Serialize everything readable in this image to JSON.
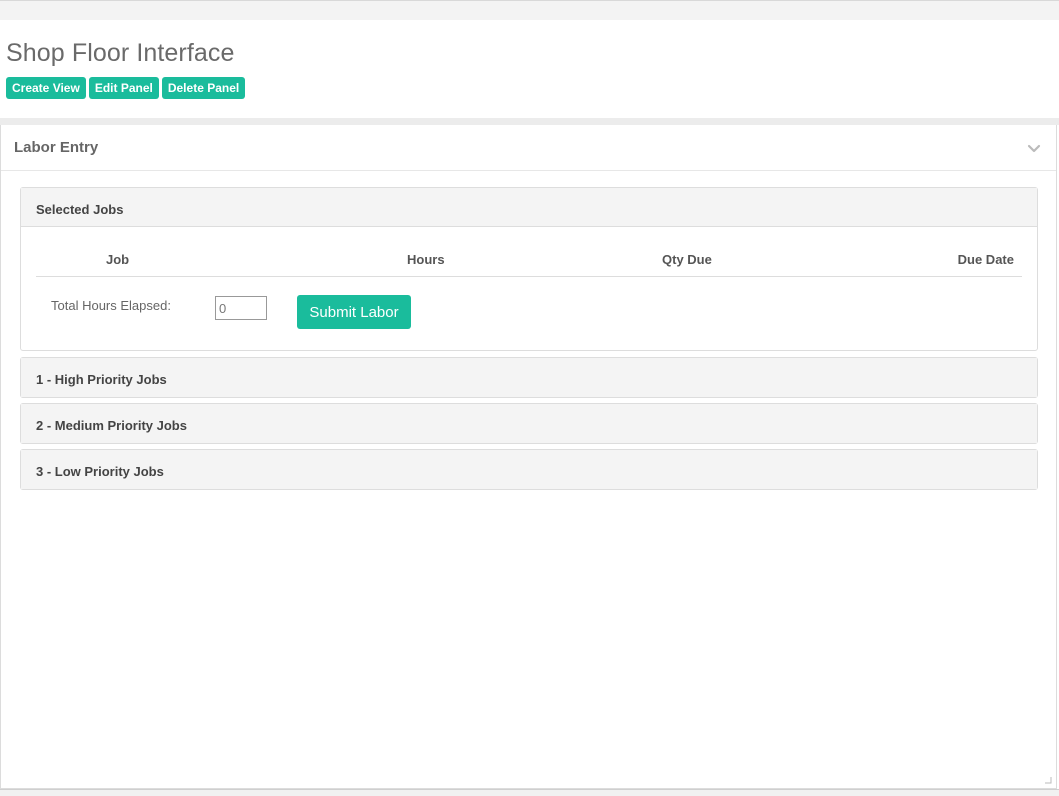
{
  "page": {
    "title": "Shop Floor Interface"
  },
  "toolbar": {
    "create_view_label": "Create View",
    "edit_panel_label": "Edit Panel",
    "delete_panel_label": "Delete Panel"
  },
  "labor_panel": {
    "title": "Labor Entry",
    "collapse_icon": "chevron-down-icon"
  },
  "selected_jobs": {
    "title": "Selected Jobs",
    "columns": [
      "Job",
      "Hours",
      "Qty Due",
      "Due Date"
    ],
    "rows": [],
    "total_hours_label": "Total Hours Elapsed:",
    "total_hours_value": "0",
    "submit_label": "Submit Labor"
  },
  "priority_sections": [
    {
      "title": "1 - High Priority Jobs"
    },
    {
      "title": "2 - Medium Priority Jobs"
    },
    {
      "title": "3 - Low Priority Jobs"
    }
  ],
  "colors": {
    "accent": "#1abc9c",
    "section_header_bg": "#f4f4f4"
  }
}
